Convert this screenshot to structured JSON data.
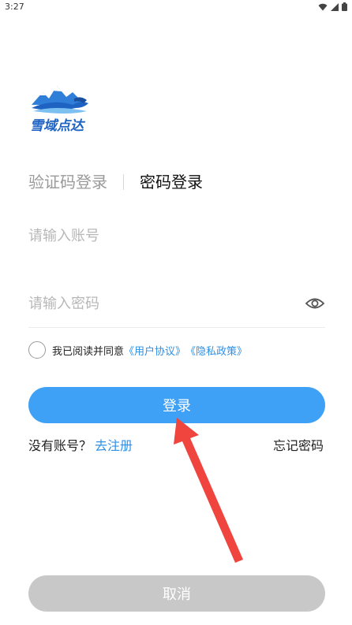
{
  "status_bar": {
    "time": "3:27"
  },
  "logo": {
    "text": "雪域点达"
  },
  "tabs": [
    {
      "label": "验证码登录",
      "active": false
    },
    {
      "label": "密码登录",
      "active": true
    }
  ],
  "form": {
    "account_placeholder": "请输入账号",
    "password_placeholder": "请输入密码"
  },
  "agreement": {
    "text": "我已阅读并同意",
    "user_agreement": "《用户协议》",
    "privacy_policy": "《隐私政策》"
  },
  "login_button": "登录",
  "register": {
    "question": "没有账号？",
    "link": "去注册"
  },
  "forgot_password": "忘记密码",
  "cancel_button": "取消",
  "colors": {
    "primary": "#3fa1f5",
    "link": "#2f8fe4",
    "disabled": "#c8c8c8",
    "arrow": "#f0443f"
  }
}
